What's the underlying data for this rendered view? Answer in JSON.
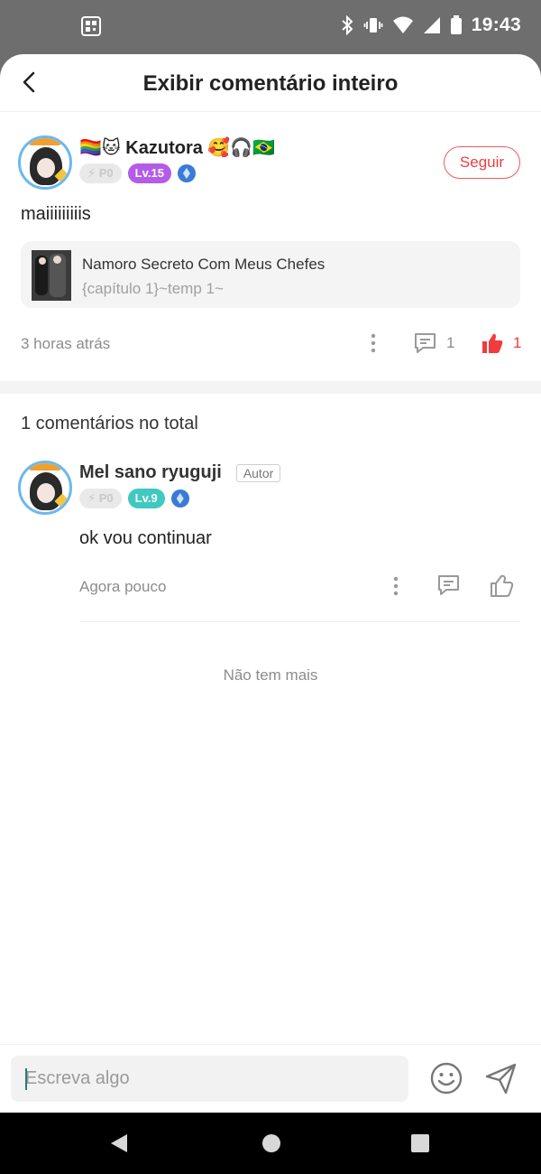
{
  "status_bar": {
    "time": "19:43",
    "icons": [
      "qr-icon",
      "bluetooth-icon",
      "vibrate-icon",
      "wifi-icon",
      "signal-icon",
      "battery-icon"
    ]
  },
  "header": {
    "title": "Exibir comentário inteiro",
    "back_icon": "back-arrow-icon"
  },
  "post": {
    "author": {
      "name": "🏳️‍🌈🐱 Kazutora 🥰🎧🇧🇷",
      "points_badge": "⚡ P0",
      "level_badge": "Lv.15",
      "level_color": "#b35ce8"
    },
    "follow_label": "Seguir",
    "text": "maiiiiiiiiis",
    "work": {
      "title": "Namoro Secreto Com Meus Chefes",
      "chapter": "{capítulo 1}~temp 1~"
    },
    "time": "3 horas atrás",
    "comment_count": "1",
    "like_count": "1",
    "accent_color": "#f03c3c"
  },
  "comments": {
    "total_label": "1 comentários no total",
    "items": [
      {
        "name": "Mel sano ryuguji",
        "tag": "Autor",
        "points_badge": "⚡ P0",
        "level_badge": "Lv.9",
        "level_color": "#3fc9c0",
        "text": "ok vou continuar",
        "time": "Agora pouco"
      }
    ],
    "end_label": "Não tem mais"
  },
  "composer": {
    "placeholder": "Escreva algo",
    "emoji_icon": "smiley-icon",
    "send_icon": "send-icon"
  },
  "nav_bar": {
    "icons": [
      "nav-back-icon",
      "nav-home-icon",
      "nav-recents-icon"
    ]
  }
}
